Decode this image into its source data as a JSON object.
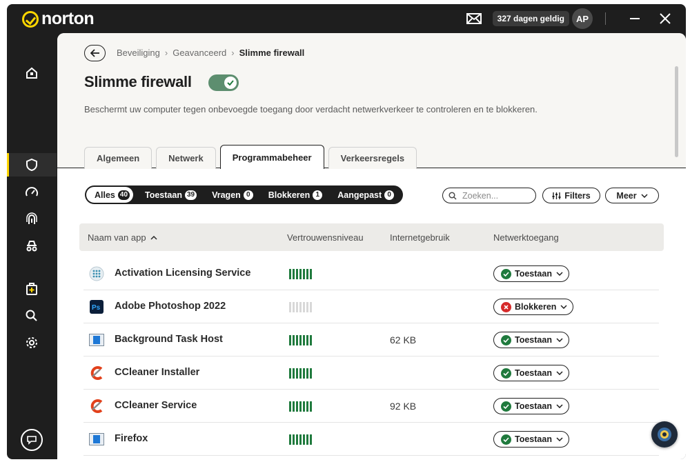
{
  "app": {
    "logo": "norton"
  },
  "titlebar": {
    "valid_days": "327 dagen geldig",
    "avatar": "AP"
  },
  "breadcrumb": [
    "Beveiliging",
    "Geavanceerd",
    "Slimme firewall"
  ],
  "page": {
    "title": "Slimme firewall",
    "toggle_on": true,
    "description": "Beschermt uw computer tegen onbevoegde toegang door verdacht netwerkverkeer te controleren en te blokkeren."
  },
  "tabs": [
    "Algemeen",
    "Netwerk",
    "Programmabeheer",
    "Verkeersregels"
  ],
  "active_tab": "Programmabeheer",
  "filters": [
    {
      "label": "Alles",
      "count": "40"
    },
    {
      "label": "Toestaan",
      "count": "39"
    },
    {
      "label": "Vragen",
      "count": "0"
    },
    {
      "label": "Blokkeren",
      "count": "1"
    },
    {
      "label": "Aangepast",
      "count": "0"
    }
  ],
  "search": {
    "placeholder": "Zoeken..."
  },
  "buttons": {
    "filters": "Filters",
    "meer": "Meer"
  },
  "table": {
    "columns": [
      "Naam van app",
      "Vertrouwensniveau",
      "Internetgebruik",
      "Netwerktoegang"
    ],
    "rows": [
      {
        "name": "Activation Licensing Service",
        "icon": "dots-grid-icon",
        "trust_level": 7,
        "usage": "",
        "access": "Toestaan",
        "status": "allow"
      },
      {
        "name": "Adobe Photoshop 2022",
        "icon": "photoshop-icon",
        "trust_level": 0,
        "usage": "",
        "access": "Blokkeren",
        "status": "block"
      },
      {
        "name": "Background Task Host",
        "icon": "window-app-icon",
        "trust_level": 7,
        "usage": "62 KB",
        "access": "Toestaan",
        "status": "allow"
      },
      {
        "name": "CCleaner Installer",
        "icon": "ccleaner-icon",
        "trust_level": 7,
        "usage": "",
        "access": "Toestaan",
        "status": "allow"
      },
      {
        "name": "CCleaner Service",
        "icon": "ccleaner-icon",
        "trust_level": 7,
        "usage": "92 KB",
        "access": "Toestaan",
        "status": "allow"
      },
      {
        "name": "Firefox",
        "icon": "window-app-icon",
        "trust_level": 7,
        "usage": "",
        "access": "Toestaan",
        "status": "allow"
      }
    ]
  },
  "colors": {
    "accent": "#ffd600",
    "allow": "#1f7a3d",
    "block": "#d62a2a",
    "dark": "#1e1e1e"
  }
}
